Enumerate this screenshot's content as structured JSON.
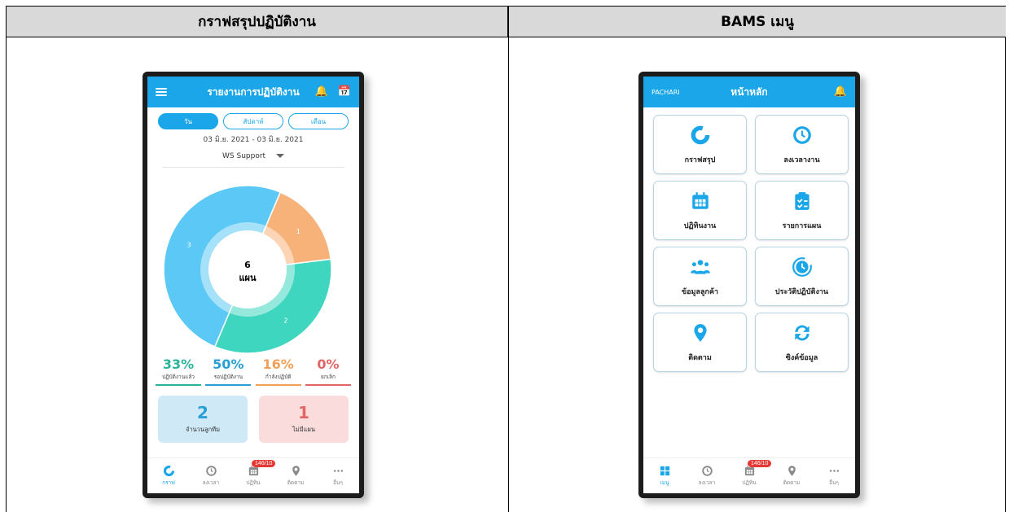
{
  "table": {
    "left_header": "กราฟสรุปปฏิบัติงาน",
    "right_header": "BAMS เมนู"
  },
  "summary_screen": {
    "title": "รายงานการปฏิบัติงาน",
    "tabs": [
      {
        "label": "วัน",
        "active": true
      },
      {
        "label": "สัปดาห์",
        "active": false
      },
      {
        "label": "เดือน",
        "active": false
      }
    ],
    "date_range": "03 มิ.ย. 2021 - 03 มิ.ย. 2021",
    "team_select": "WS Support",
    "donut_center_number": "6",
    "donut_center_label": "แผน",
    "stats": [
      {
        "pct": "33%",
        "label": "ปฏิบัติงานแล้ว",
        "color": "#2bb39a"
      },
      {
        "pct": "50%",
        "label": "รอปฏิบัติงาน",
        "color": "#2a9fd6"
      },
      {
        "pct": "16%",
        "label": "กำลังปฏิบัติ",
        "color": "#f0a057"
      },
      {
        "pct": "0%",
        "label": "ยกเลิก",
        "color": "#e06666"
      }
    ],
    "boxes": [
      {
        "num": "2",
        "caption": "จำนวนลูกทีม",
        "bg": "#cfe9f7",
        "color": "#2a9fd6"
      },
      {
        "num": "1",
        "caption": "ไม่มีแผน",
        "bg": "#fbdcdc",
        "color": "#e06666"
      }
    ],
    "nav": [
      {
        "icon": "chart-icon",
        "label": "กราฟ",
        "active": true
      },
      {
        "icon": "clock-icon",
        "label": "ลงเวลา",
        "active": false
      },
      {
        "icon": "calendar-icon",
        "label": "ปฏิทิน",
        "badge": "146/10",
        "active": false
      },
      {
        "icon": "location-icon",
        "label": "ติดตาม",
        "active": false
      },
      {
        "icon": "more-icon",
        "label": "อื่นๆ",
        "active": false
      }
    ]
  },
  "chart_data": {
    "type": "pie",
    "categories": [
      "1",
      "3",
      "2"
    ],
    "values": [
      1,
      3,
      2
    ],
    "colors": [
      "#f7b27a",
      "#5bc8f5",
      "#3fd6c0"
    ]
  },
  "menu_screen": {
    "user": "PACHARI",
    "title": "หน้าหลัก",
    "tiles": [
      {
        "icon": "chart-icon",
        "label": "กราฟสรุป"
      },
      {
        "icon": "clock-icon",
        "label": "ลงเวลางาน"
      },
      {
        "icon": "calendar-icon",
        "label": "ปฏิทินงาน"
      },
      {
        "icon": "clipboard-icon",
        "label": "รายการแผน"
      },
      {
        "icon": "customers-icon",
        "label": "ข้อมูลลูกค้า"
      },
      {
        "icon": "history-icon",
        "label": "ประวัติปฏิบัติงาน"
      },
      {
        "icon": "location-icon",
        "label": "ติดตาม"
      },
      {
        "icon": "sync-icon",
        "label": "ซิงค์ข้อมูล"
      }
    ],
    "nav": [
      {
        "icon": "menu-grid-icon",
        "label": "เมนู",
        "active": true
      },
      {
        "icon": "clock-icon",
        "label": "ลงเวลา",
        "active": false
      },
      {
        "icon": "calendar-icon",
        "label": "ปฏิทิน",
        "badge": "146/10",
        "active": false
      },
      {
        "icon": "location-icon",
        "label": "ติดตาม",
        "active": false
      },
      {
        "icon": "more-icon",
        "label": "อื่นๆ",
        "active": false
      }
    ]
  }
}
